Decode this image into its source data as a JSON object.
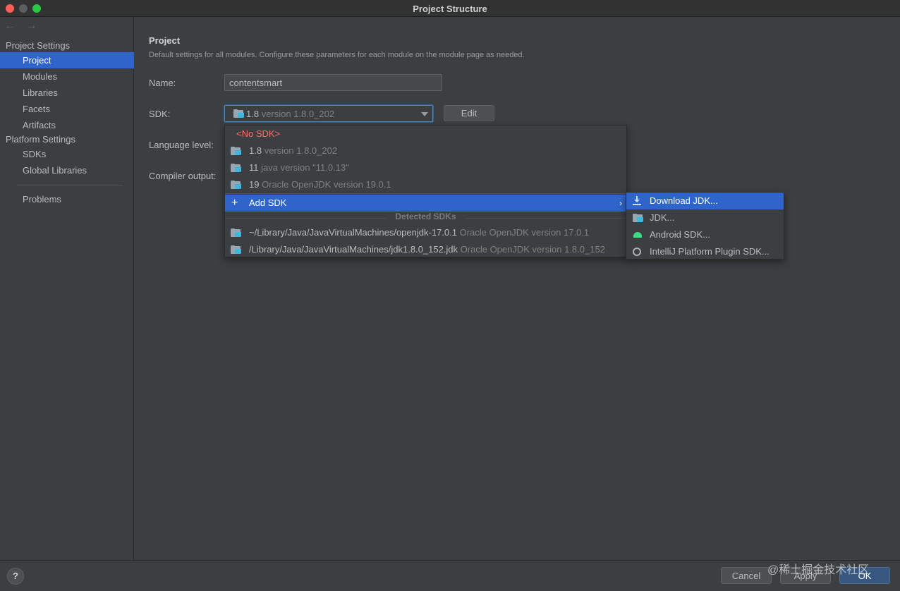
{
  "window": {
    "title": "Project Structure"
  },
  "nav": {
    "back_arrow": "←",
    "forward_arrow": "→"
  },
  "sidebar": {
    "project_settings_title": "Project Settings",
    "project_items": [
      {
        "label": "Project",
        "selected": true
      },
      {
        "label": "Modules",
        "selected": false
      },
      {
        "label": "Libraries",
        "selected": false
      },
      {
        "label": "Facets",
        "selected": false
      },
      {
        "label": "Artifacts",
        "selected": false
      }
    ],
    "platform_settings_title": "Platform Settings",
    "platform_items": [
      {
        "label": "SDKs"
      },
      {
        "label": "Global Libraries"
      }
    ],
    "problems_label": "Problems"
  },
  "main": {
    "heading": "Project",
    "description": "Default settings for all modules. Configure these parameters for each module on the module page as needed.",
    "name_label": "Name:",
    "name_value": "contentsmart",
    "sdk_label": "SDK:",
    "sdk_selected_name": "1.8",
    "sdk_selected_version": "version 1.8.0_202",
    "edit_button": "Edit",
    "language_level_label": "Language level:",
    "compiler_output_label": "Compiler output:"
  },
  "sdk_dropdown": {
    "no_sdk": "<No SDK>",
    "sdks": [
      {
        "name": "1.8",
        "detail": "version 1.8.0_202"
      },
      {
        "name": "11",
        "detail": "java version \"11.0.13\""
      },
      {
        "name": "19",
        "detail": "Oracle OpenJDK version 19.0.1"
      }
    ],
    "add_sdk": "Add SDK",
    "plus_glyph": "+",
    "chevron_glyph": "›",
    "detected_header": "Detected SDKs",
    "detected": [
      {
        "path": "~/Library/Java/JavaVirtualMachines/openjdk-17.0.1",
        "detail": "Oracle OpenJDK version 17.0.1"
      },
      {
        "path": "/Library/Java/JavaVirtualMachines/jdk1.8.0_152.jdk",
        "detail": "Oracle OpenJDK version 1.8.0_152"
      }
    ]
  },
  "add_sdk_submenu": {
    "items": [
      {
        "label": "Download JDK...",
        "icon": "download-icon",
        "active": true
      },
      {
        "label": "JDK...",
        "icon": "folder-icon",
        "active": false
      },
      {
        "label": "Android SDK...",
        "icon": "android-icon",
        "active": false
      },
      {
        "label": "IntelliJ Platform Plugin SDK...",
        "icon": "plugin-icon",
        "active": false
      }
    ]
  },
  "footer": {
    "help": "?",
    "cancel": "Cancel",
    "apply": "Apply",
    "ok": "OK",
    "watermark": "@稀土掘金技术社区"
  },
  "colors": {
    "selection": "#2f65ca",
    "no_sdk_red": "#ff6b68",
    "background": "#3c3f41"
  }
}
